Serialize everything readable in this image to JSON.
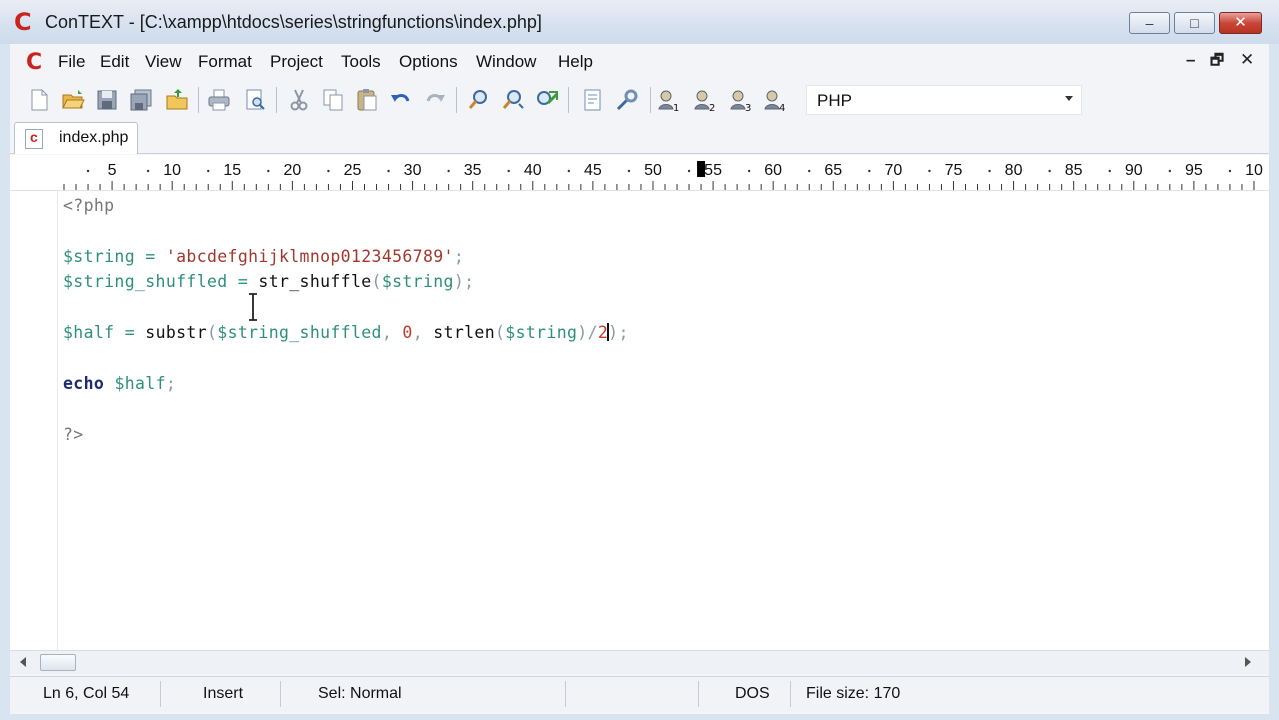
{
  "window": {
    "title": "ConTEXT - [C:\\xampp\\htdocs\\series\\stringfunctions\\index.php]",
    "logo": "C",
    "buttons": {
      "minimize": "–",
      "maximize": "□",
      "close": "✕"
    }
  },
  "menu": {
    "items": [
      "File",
      "Edit",
      "View",
      "Format",
      "Project",
      "Tools",
      "Options",
      "Window",
      "Help"
    ],
    "mdi_controls": [
      "–",
      "🗗",
      "✕"
    ]
  },
  "toolbar": {
    "icons": [
      "new-file-icon",
      "open-folder-icon",
      "save-icon",
      "save-all-icon",
      "open-project-icon",
      "print-icon",
      "print-preview-icon",
      "cut-icon",
      "copy-icon",
      "paste-icon",
      "undo-icon",
      "redo-icon",
      "find-icon",
      "find-next-icon",
      "replace-icon",
      "export-icon",
      "tools-icon",
      "user-command-1-icon",
      "user-command-2-icon",
      "user-command-3-icon",
      "user-command-4-icon"
    ],
    "language": "PHP"
  },
  "tabs": [
    {
      "label": "index.php",
      "active": true
    }
  ],
  "ruler": {
    "labels": [
      "5",
      "10",
      "15",
      "20",
      "25",
      "30",
      "35",
      "40",
      "45",
      "50",
      "55",
      "60",
      "65",
      "70",
      "75",
      "80",
      "85",
      "90",
      "95",
      "10"
    ],
    "cursor_column": 54
  },
  "editor": {
    "lines": {
      "l1": {
        "open_tag": "<?php"
      },
      "l3": {
        "var": "$string",
        "eq": " = ",
        "str": "'abcdefghijklmnop0123456789'",
        "end": ";"
      },
      "l4": {
        "var": "$string_shuffled",
        "eq": " = ",
        "fn": "str_shuffle",
        "open": "(",
        "arg": "$string",
        "close": ")",
        "end": ";"
      },
      "l6": {
        "var": "$half",
        "eq": " = ",
        "fn": "substr",
        "open": "(",
        "arg1": "$string_shuffled",
        "comma1": ", ",
        "num0": "0",
        "comma2": ", ",
        "fn2": "strlen",
        "open2": "(",
        "arg2": "$string",
        "close2": ")",
        "div": "/",
        "num2": "2",
        "close": ")",
        "end": ";"
      },
      "l8": {
        "kw": "echo",
        "sp": " ",
        "var": "$half",
        "end": ";"
      },
      "l10": {
        "close_tag": "?>"
      }
    }
  },
  "status": {
    "position": "Ln 6, Col 54",
    "mode": "Insert",
    "selection": "Sel: Normal",
    "line_endings": "DOS",
    "file_size": "File size: 170"
  }
}
